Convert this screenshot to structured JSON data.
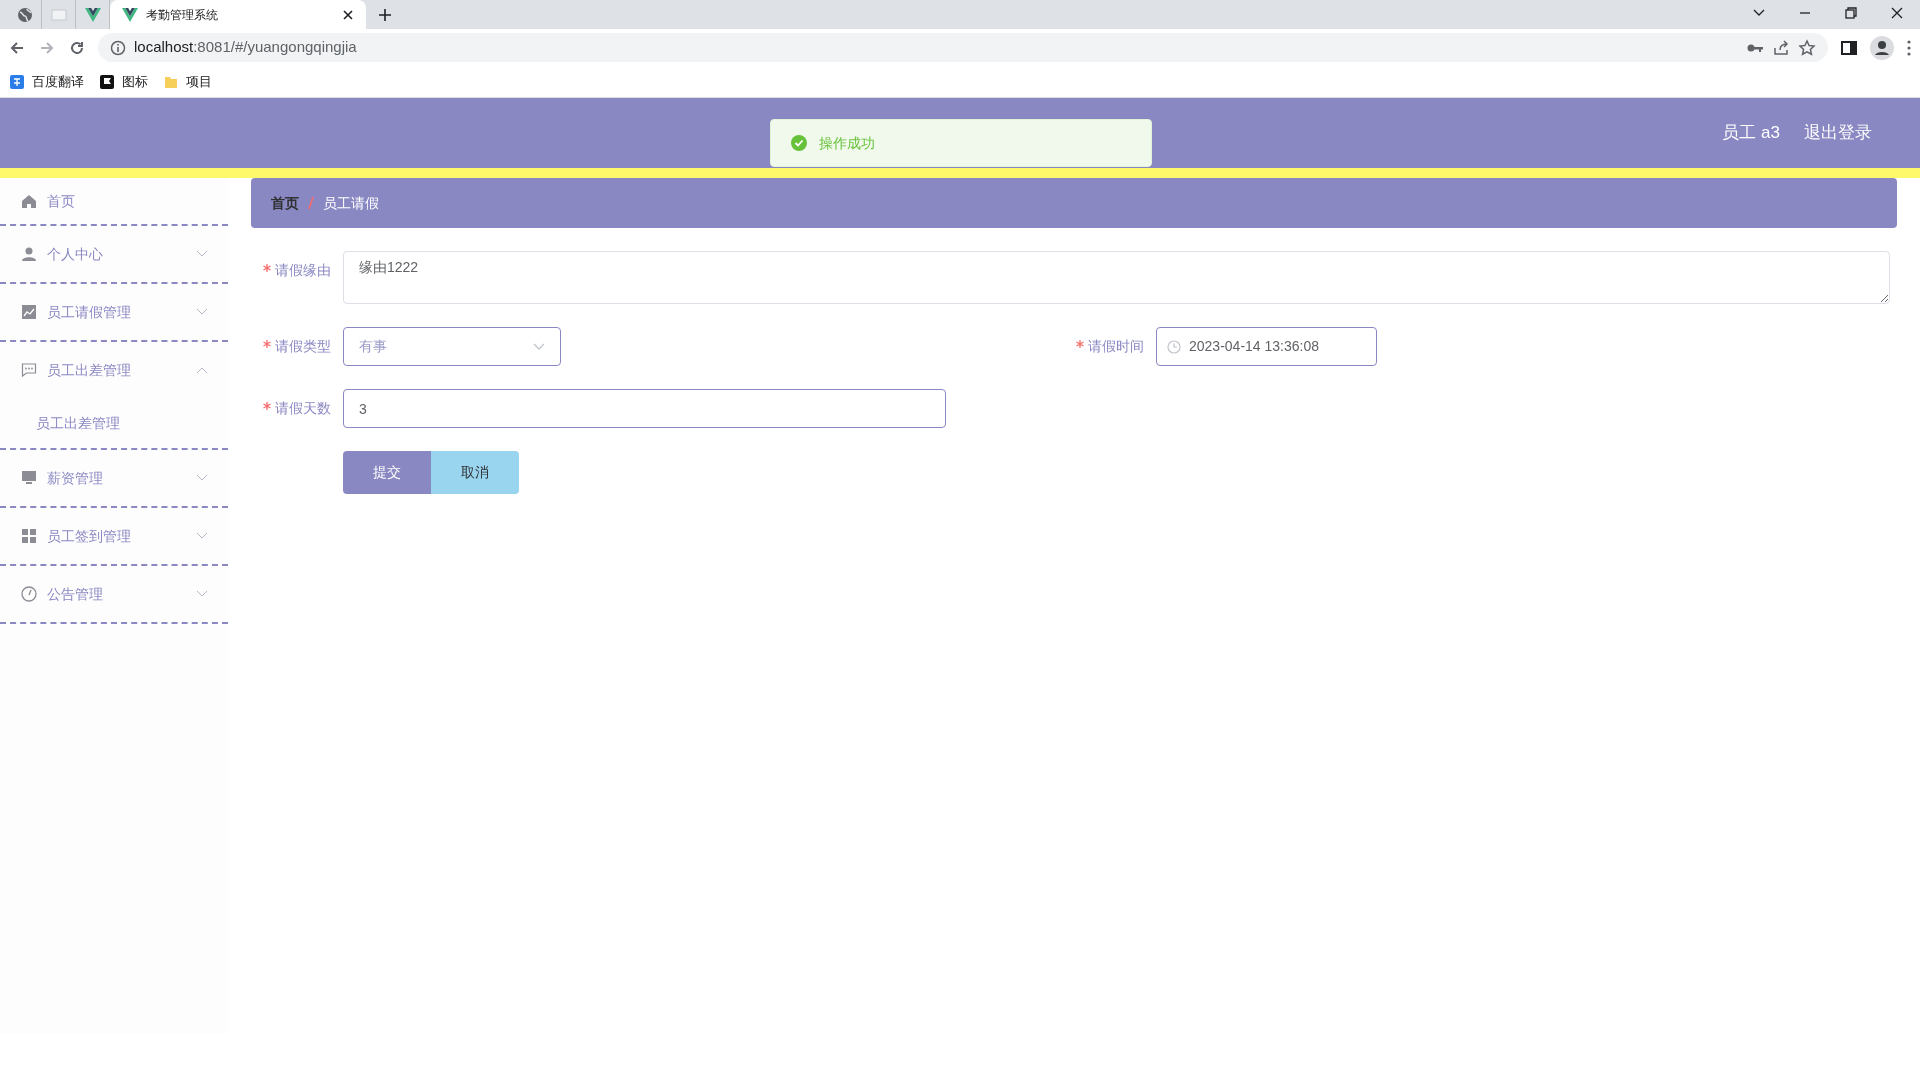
{
  "browser": {
    "tabs": [
      {
        "kind": "globe",
        "selected": false
      },
      {
        "kind": "blank",
        "selected": false
      },
      {
        "kind": "vue",
        "selected": false
      },
      {
        "kind": "vue",
        "title": "考勤管理系统",
        "selected": true
      }
    ],
    "address": {
      "host": "localhost",
      "rest": ":8081/#/yuangongqingjia"
    },
    "bookmarks": [
      {
        "kind": "translate",
        "label": "百度翻译"
      },
      {
        "kind": "flag",
        "label": "图标"
      },
      {
        "kind": "folder",
        "label": "项目"
      }
    ]
  },
  "header": {
    "toast": "操作成功",
    "user": "员工 a3",
    "logout": "退出登录"
  },
  "sidebar": {
    "items": [
      {
        "kind": "home",
        "label": "首页"
      },
      {
        "kind": "user",
        "label": "个人中心",
        "expanded": false
      },
      {
        "kind": "chart",
        "label": "员工请假管理",
        "expanded": false
      },
      {
        "kind": "chat",
        "label": "员工出差管理",
        "expanded": true,
        "children": [
          {
            "label": "员工出差管理"
          }
        ]
      },
      {
        "kind": "monitor",
        "label": "薪资管理",
        "expanded": false
      },
      {
        "kind": "grid",
        "label": "员工签到管理",
        "expanded": false
      },
      {
        "kind": "gauge",
        "label": "公告管理",
        "expanded": false
      }
    ]
  },
  "breadcrumb": [
    "首页",
    "员工请假"
  ],
  "form": {
    "reason": {
      "label": "请假缘由",
      "value": "缘由1222"
    },
    "type": {
      "label": "请假类型",
      "value": "有事"
    },
    "time": {
      "label": "请假时间",
      "value": "2023-04-14 13:36:08"
    },
    "days": {
      "label": "请假天数",
      "value": "3"
    },
    "buttons": [
      {
        "kind": "primary",
        "label": "提交"
      },
      {
        "kind": "secondary",
        "label": "取消"
      }
    ]
  }
}
